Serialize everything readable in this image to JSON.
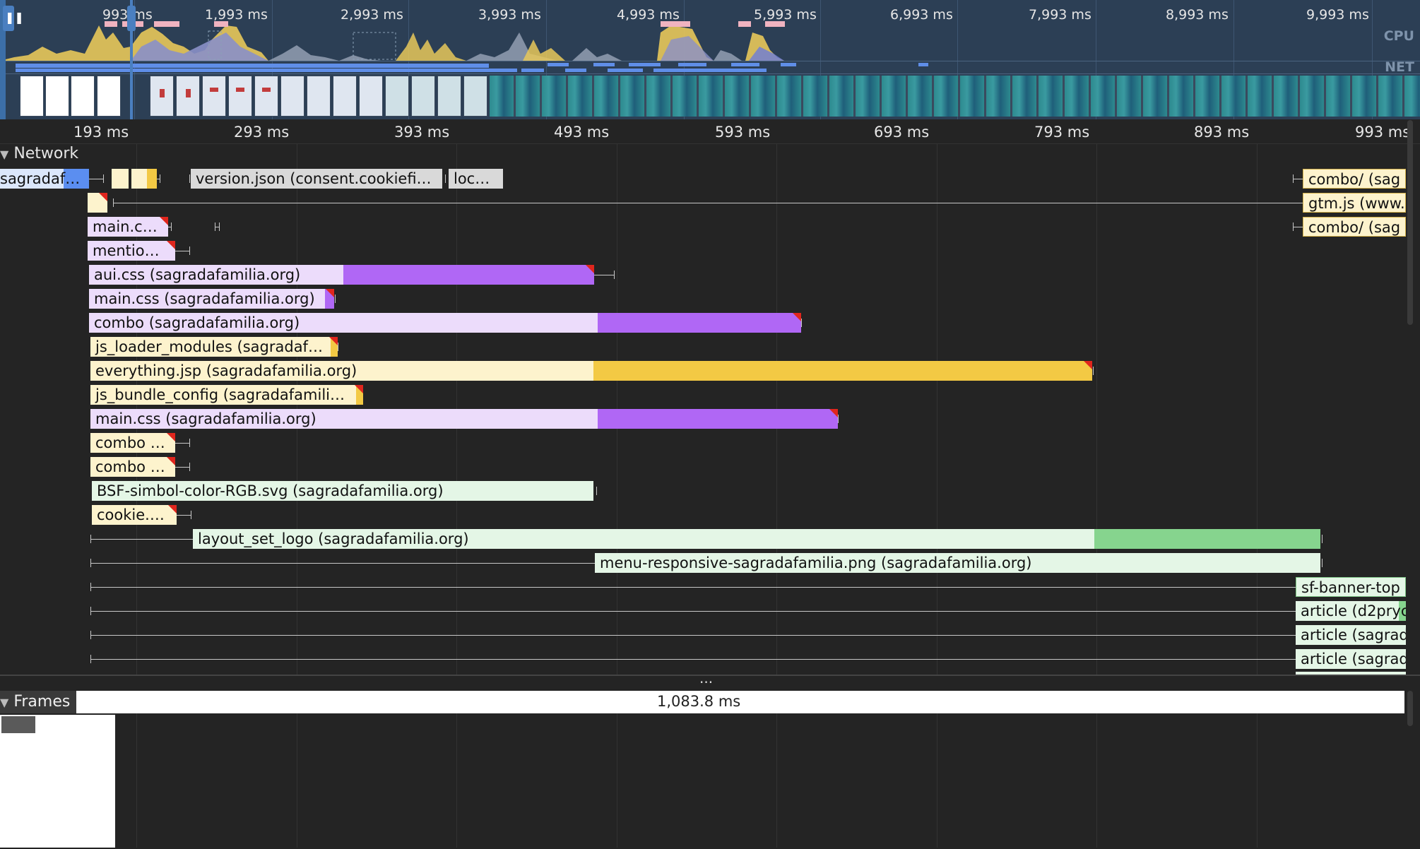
{
  "overview": {
    "time_labels": [
      "993 ms",
      "1,993 ms",
      "2,993 ms",
      "3,993 ms",
      "4,993 ms",
      "5,993 ms",
      "6,993 ms",
      "7,993 ms",
      "8,993 ms",
      "9,993 ms"
    ],
    "cpu_label": "CPU",
    "net_label": "NET",
    "pause_icon": "pause-icon"
  },
  "ruler": {
    "labels": [
      "193 ms",
      "293 ms",
      "393 ms",
      "493 ms",
      "593 ms",
      "693 ms",
      "793 ms",
      "893 ms",
      "993 ms"
    ]
  },
  "network": {
    "title": "Network",
    "rows": [
      {
        "label": "sagradaf…"
      },
      {
        "label": "version.json (consent.cookiefi…"
      },
      {
        "label": "loc…"
      },
      {
        "label": "combo/ (sag"
      },
      {
        "label": "gtm.js (www."
      },
      {
        "label": "main.c…"
      },
      {
        "label": "combo/ (sag"
      },
      {
        "label": "mentio…"
      },
      {
        "label": "aui.css (sagradafamilia.org)"
      },
      {
        "label": "main.css (sagradafamilia.org)"
      },
      {
        "label": "combo (sagradafamilia.org)"
      },
      {
        "label": "js_loader_modules (sagradaf…"
      },
      {
        "label": "everything.jsp (sagradafamilia.org)"
      },
      {
        "label": "js_bundle_config (sagradafamili…"
      },
      {
        "label": "main.css (sagradafamilia.org)"
      },
      {
        "label": "combo …"
      },
      {
        "label": "combo …"
      },
      {
        "label": "BSF-simbol-color-RGB.svg (sagradafamilia.org)"
      },
      {
        "label": "cookie.…"
      },
      {
        "label": "layout_set_logo (sagradafamilia.org)"
      },
      {
        "label": "menu-responsive-sagradafamilia.png (sagradafamilia.org)"
      },
      {
        "label": "sf-banner-top"
      },
      {
        "label": "article (d2pryc"
      },
      {
        "label": "article (sagrad"
      },
      {
        "label": "article (sagrad"
      }
    ],
    "colors": {
      "doc": "#5b8ef0",
      "script_light": "#fdf3cd",
      "script_dark": "#f3c944",
      "css_light": "#ecdcfb",
      "css_dark": "#b067f5",
      "img_light": "#e4f6e6",
      "img_dark": "#86d48e",
      "other": "#d9d9d9"
    }
  },
  "frames": {
    "title": "Frames",
    "duration": "1,083.8 ms"
  },
  "divider_dots": "..."
}
